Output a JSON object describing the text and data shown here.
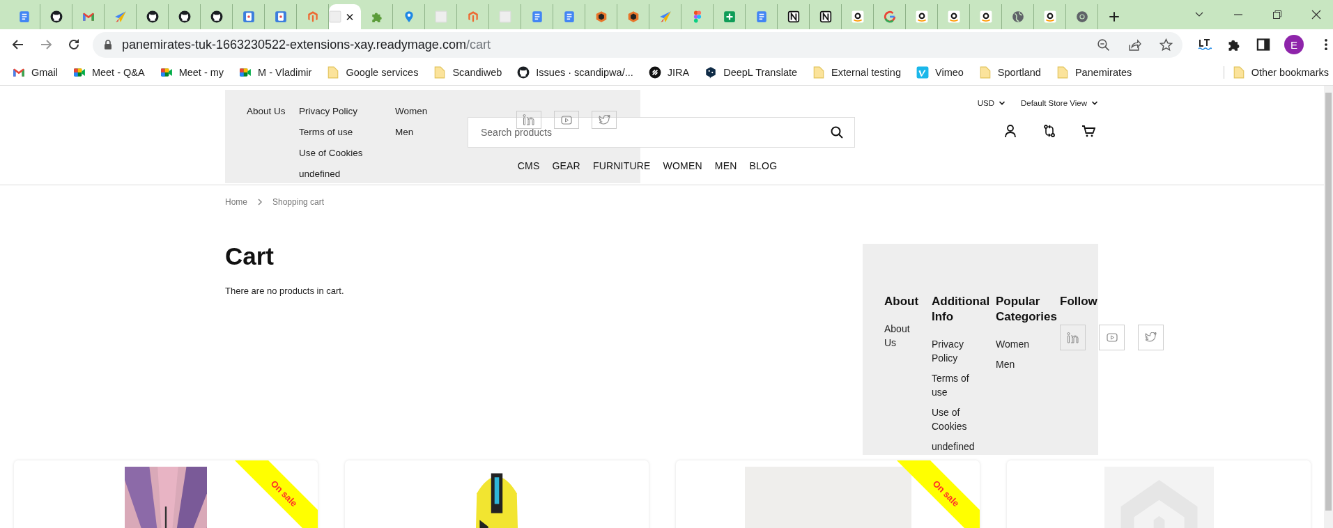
{
  "browser": {
    "tabs": [
      {
        "kind": "docs",
        "selected": false
      },
      {
        "kind": "github",
        "selected": false
      },
      {
        "kind": "gmail",
        "selected": false
      },
      {
        "kind": "plane",
        "selected": false
      },
      {
        "kind": "github",
        "selected": false
      },
      {
        "kind": "github",
        "selected": false
      },
      {
        "kind": "github",
        "selected": false
      },
      {
        "kind": "phone",
        "selected": false
      },
      {
        "kind": "phone",
        "selected": false
      },
      {
        "kind": "magento",
        "selected": false
      },
      {
        "kind": "blank",
        "selected": true
      },
      {
        "kind": "puzzle",
        "selected": false
      },
      {
        "kind": "pin",
        "selected": false
      },
      {
        "kind": "blank",
        "selected": false
      },
      {
        "kind": "magento",
        "selected": false
      },
      {
        "kind": "blank",
        "selected": false
      },
      {
        "kind": "docs",
        "selected": false
      },
      {
        "kind": "docs",
        "selected": false
      },
      {
        "kind": "hex",
        "selected": false
      },
      {
        "kind": "hex",
        "selected": false
      },
      {
        "kind": "plane",
        "selected": false
      },
      {
        "kind": "figma",
        "selected": false
      },
      {
        "kind": "sheets",
        "selected": false
      },
      {
        "kind": "docs",
        "selected": false
      },
      {
        "kind": "notion",
        "selected": false
      },
      {
        "kind": "notion",
        "selected": false
      },
      {
        "kind": "amazon",
        "selected": false
      },
      {
        "kind": "google",
        "selected": false
      },
      {
        "kind": "amazon",
        "selected": false
      },
      {
        "kind": "amazon",
        "selected": false
      },
      {
        "kind": "amazon",
        "selected": false
      },
      {
        "kind": "globe",
        "selected": false
      },
      {
        "kind": "amazon",
        "selected": false
      },
      {
        "kind": "chrome",
        "selected": false
      }
    ],
    "url_host": "panemirates-tuk-1663230522-extensions-xay.readymage.com",
    "url_path": "/cart",
    "profile_initial": "E",
    "bookmarks": [
      {
        "kind": "gmail",
        "label": "Gmail"
      },
      {
        "kind": "meet",
        "label": "Meet - Q&A"
      },
      {
        "kind": "meet",
        "label": "Meet - my"
      },
      {
        "kind": "meet",
        "label": "M - Vladimir"
      },
      {
        "kind": "folder",
        "label": "Google services"
      },
      {
        "kind": "folder",
        "label": "Scandiweb"
      },
      {
        "kind": "github",
        "label": "Issues · scandipwa/..."
      },
      {
        "kind": "jira",
        "label": "JIRA"
      },
      {
        "kind": "deepl",
        "label": "DeepL Translate"
      },
      {
        "kind": "folder",
        "label": "External testing"
      },
      {
        "kind": "vimeo",
        "label": "Vimeo"
      },
      {
        "kind": "folder",
        "label": "Sportland"
      },
      {
        "kind": "folder",
        "label": "Panemirates"
      }
    ],
    "other_bookmarks": "Other bookmarks"
  },
  "header": {
    "overlay_menu": [
      [
        "About Us"
      ],
      [
        "Privacy Policy",
        "Terms of use",
        "Use of Cookies",
        "undefined"
      ],
      [
        "Women",
        "Men"
      ]
    ],
    "overlay_social": [
      {
        "kind": "linkedin"
      },
      {
        "kind": "youtube"
      },
      {
        "kind": "twitter"
      }
    ],
    "search": {
      "placeholder": "Search products"
    },
    "nav": [
      "CMS",
      "GEAR",
      "FURNITURE",
      "WOMEN",
      "MEN",
      "BLOG"
    ],
    "currency": "USD",
    "store_view": "Default Store View"
  },
  "breadcrumbs": [
    "Home",
    "Shopping cart"
  ],
  "cart": {
    "title": "Cart",
    "empty_message": "There are no products in cart."
  },
  "footer": {
    "columns": [
      {
        "title": "About",
        "links": [
          "About Us"
        ]
      },
      {
        "title": "Additional Info",
        "links": [
          "Privacy Policy",
          "Terms of use",
          "Use of Cookies",
          "undefined"
        ]
      },
      {
        "title": "Popular Categories",
        "links": [
          "Women",
          "Men"
        ]
      },
      {
        "title": "Follow",
        "social": [
          {
            "kind": "linkedin"
          },
          {
            "kind": "youtube"
          },
          {
            "kind": "twitter"
          }
        ]
      }
    ]
  },
  "products": [
    {
      "kind": "picture",
      "badge": "On sale"
    },
    {
      "kind": "picture"
    },
    {
      "kind": "picture",
      "badge": "On sale"
    },
    {
      "kind": "picture"
    }
  ]
}
